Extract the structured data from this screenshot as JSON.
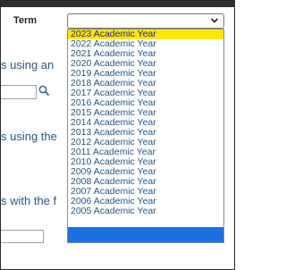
{
  "term": {
    "label": "Term",
    "selected_value": ""
  },
  "fragments": [
    {
      "text": "s using an"
    },
    {
      "text": "s using the"
    },
    {
      "text": "s with the f"
    }
  ],
  "dropdown": {
    "options": [
      "2023 Academic Year",
      "2022 Academic Year",
      "2021 Academic Year",
      "2020 Academic Year",
      "2019 Academic Year",
      "2018 Academic Year",
      "2017 Academic Year",
      "2016 Academic Year",
      "2015 Academic Year",
      "2014 Academic Year",
      "2013 Academic Year",
      "2012 Academic Year",
      "2011 Academic Year",
      "2010 Academic Year",
      "2009 Academic Year",
      "2008 Academic Year",
      "2007 Academic Year",
      "2006 Academic Year",
      "2005 Academic Year"
    ],
    "highlighted_index": 0,
    "colors": {
      "highlight": "#ffe600",
      "option_text": "#2a5680",
      "blue_block": "#1b6fe0"
    }
  },
  "icons": {
    "select_toggle": "chevron-down-icon",
    "lookup": "search-icon"
  }
}
